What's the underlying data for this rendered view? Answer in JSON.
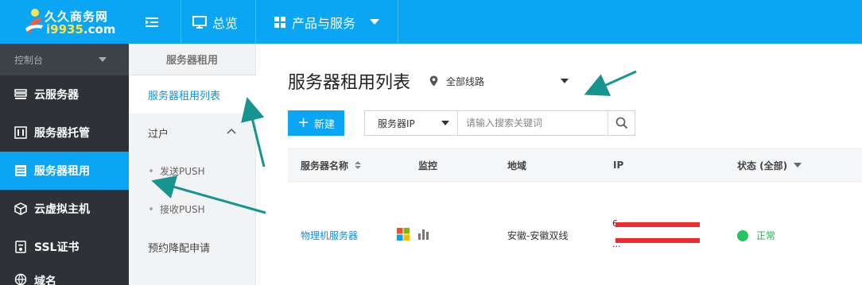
{
  "brand": {
    "name_cn": "久久商务网",
    "domain_num": "i9935",
    "domain_tld": ".com"
  },
  "topnav": {
    "overview": "总览",
    "products": "产品与服务"
  },
  "sidebar": {
    "header": "控制台",
    "items": [
      {
        "label": "云服务器",
        "icon": "list-icon"
      },
      {
        "label": "服务器托管",
        "icon": "rack-icon"
      },
      {
        "label": "服务器租用",
        "icon": "table-icon"
      },
      {
        "label": "云虚拟主机",
        "icon": "cube-icon"
      },
      {
        "label": "SSL证书",
        "icon": "certificate-icon"
      },
      {
        "label": "域名",
        "icon": "globe-icon"
      }
    ]
  },
  "subnav": {
    "title": "服务器租用",
    "active": "服务器租用列表",
    "group": "过户",
    "children": [
      "发送PUSH",
      "接收PUSH"
    ],
    "extra": "预约降配申请"
  },
  "main": {
    "title": "服务器租用列表",
    "region_filter": "全部线路",
    "new_button": "新建",
    "search": {
      "field": "服务器IP",
      "placeholder": "请输入搜索关键词"
    },
    "columns": {
      "name": "服务器名称",
      "monitor": "监控",
      "region": "地域",
      "ip": "IP",
      "status": "状态 (全部)"
    },
    "rows": [
      {
        "name": "物理机服务器",
        "region": "安徽-安徽双线",
        "ip1": "6...",
        "ip2": "...",
        "status": "正常"
      }
    ]
  },
  "colors": {
    "primary": "#0aa6f4",
    "sidebar": "#2e3237",
    "annotation_arrow": "#16958f",
    "redaction": "#ef2b2b",
    "status_ok": "#22c55e"
  }
}
